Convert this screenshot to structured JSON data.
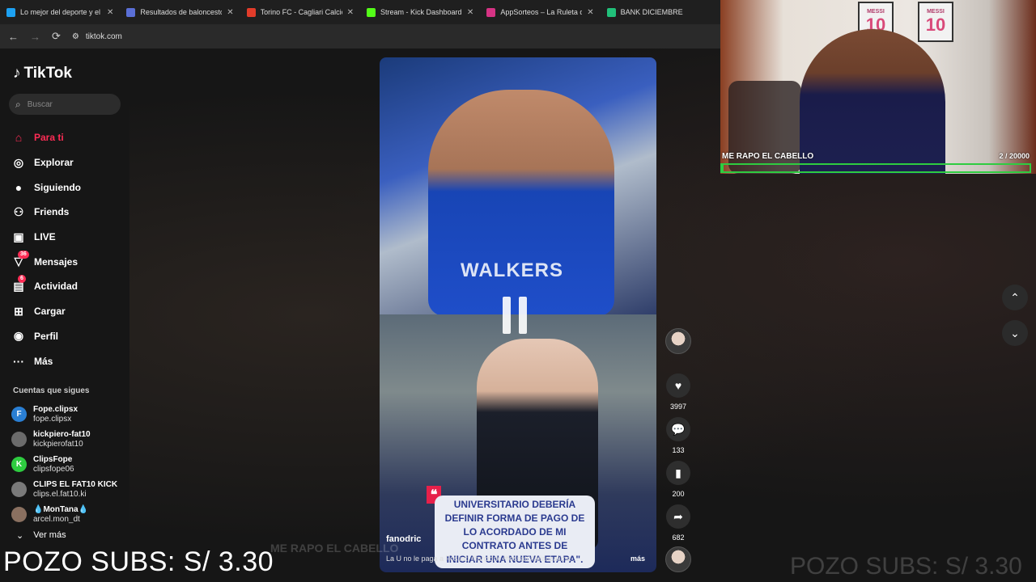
{
  "browser": {
    "tabs": [
      {
        "label": "Lo mejor del deporte y el entretenimiento",
        "color": "#1da1f2"
      },
      {
        "label": "Resultados de baloncesto en directo",
        "color": "#5a6fd6"
      },
      {
        "label": "Torino FC - Cagliari Calcio Fútbol",
        "color": "#e23c2a"
      },
      {
        "label": "Stream - Kick Dashboard",
        "color": "#53fc18"
      },
      {
        "label": "AppSorteos – La Ruleta de la Suerte",
        "color": "#d63384"
      },
      {
        "label": "BANK DICIEMBRE",
        "color": "#21c07a"
      }
    ],
    "url": "tiktok.com"
  },
  "sidebar": {
    "logo": "TikTok",
    "search_placeholder": "Buscar",
    "nav": [
      {
        "label": "Para ti",
        "icon": "home-icon",
        "badge": ""
      },
      {
        "label": "Explorar",
        "icon": "compass-icon",
        "badge": ""
      },
      {
        "label": "Siguiendo",
        "icon": "following-icon",
        "badge": ""
      },
      {
        "label": "Friends",
        "icon": "friends-icon",
        "badge": ""
      },
      {
        "label": "LIVE",
        "icon": "live-icon",
        "badge": ""
      },
      {
        "label": "Mensajes",
        "icon": "messages-icon",
        "badge": "36"
      },
      {
        "label": "Actividad",
        "icon": "activity-icon",
        "badge": "6"
      },
      {
        "label": "Cargar",
        "icon": "upload-icon",
        "badge": ""
      },
      {
        "label": "Perfil",
        "icon": "profile-icon",
        "badge": ""
      },
      {
        "label": "Más",
        "icon": "more-icon",
        "badge": ""
      }
    ],
    "following_title": "Cuentas que sigues",
    "accounts": [
      {
        "name": "Fope.clipsx",
        "handle": "fope.clipsx",
        "color": "#2a7fd4",
        "initial": "F"
      },
      {
        "name": "kickpiero-fat10",
        "handle": "kickpierofat10",
        "color": "#6b6b6b",
        "initial": ""
      },
      {
        "name": "ClipsFope",
        "handle": "clipsfope06",
        "color": "#2ecc40",
        "initial": "K"
      },
      {
        "name": "CLIPS EL FAT10 KICK",
        "handle": "clips.el.fat10.ki",
        "color": "#7a7a7a",
        "initial": ""
      },
      {
        "name": "💧MonTana💧",
        "handle": "arcel.mon_dt",
        "color": "#8a7060",
        "initial": ""
      }
    ],
    "see_more": "Ver más"
  },
  "video": {
    "jersey_text": "WALKERS",
    "quote": "UNIVERSITARIO DEBERÍA DEFINIR FORMA DE PAGO DE LO ACORDADO DE MI CONTRATO ANTES DE INICIAR UNA NUEVA ETAPA\".",
    "author": "fanodric",
    "description": "La U no le paga a Fossati #fanodric #fossati #alianzalima ...",
    "more": "más"
  },
  "actions": {
    "likes": "3997",
    "comments": "133",
    "saves": "200",
    "shares": "682"
  },
  "cam": {
    "title": "ME RAPO EL CABELLO",
    "count": "2 / 20000",
    "progress": 0.0001,
    "frame_label": "MESSI",
    "frame_number": "10"
  },
  "overlay": {
    "pozo": "POZO SUBS: S/ 3.30"
  },
  "colors": {
    "accent": "#fe2c55",
    "progress": "#2ecc40"
  }
}
